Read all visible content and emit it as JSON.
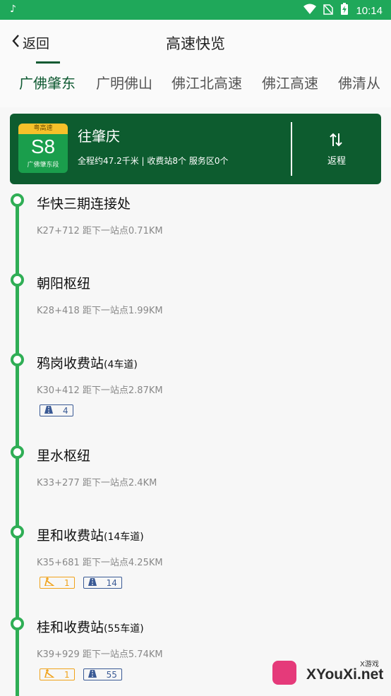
{
  "status_bar": {
    "time": "10:14",
    "icons": [
      "tiktok-icon",
      "wifi-icon",
      "no-sim-icon",
      "battery-charging-icon"
    ]
  },
  "header": {
    "back_label": "返回",
    "title": "高速快览"
  },
  "tabs": [
    "广佛肇东",
    "广明佛山",
    "佛江北高速",
    "佛江高速",
    "佛清从"
  ],
  "route": {
    "shield_top": "粤高速",
    "shield_code": "S8",
    "shield_name": "广佛肇东段",
    "direction": "往肇庆",
    "summary": "全程约47.2千米 | 收费站8个  服务区0个",
    "return_label": "返程"
  },
  "stops": [
    {
      "name": "华快三期连接处",
      "lanes": "",
      "info": "K27+712  距下一站点0.71KM"
    },
    {
      "name": "朝阳枢纽",
      "lanes": "",
      "info": "K28+418  距下一站点1.99KM"
    },
    {
      "name": "鸦岗收费站",
      "lanes": "(4车道)",
      "info": "K30+412  距下一站点2.87KM",
      "lane_count": "4"
    },
    {
      "name": "里水枢纽",
      "lanes": "",
      "info": "K33+277  距下一站点2.4KM"
    },
    {
      "name": "里和收费站",
      "lanes": "(14车道)",
      "info": "K35+681  距下一站点4.25KM",
      "etc_count": "1",
      "lane_count": "14"
    },
    {
      "name": "桂和收费站",
      "lanes": "(55车道)",
      "info": "K39+929  距下一站点5.74KM",
      "etc_count": "1",
      "lane_count": "55"
    }
  ],
  "watermark": {
    "text": "XYouXi.net",
    "sub": "X游戏"
  }
}
